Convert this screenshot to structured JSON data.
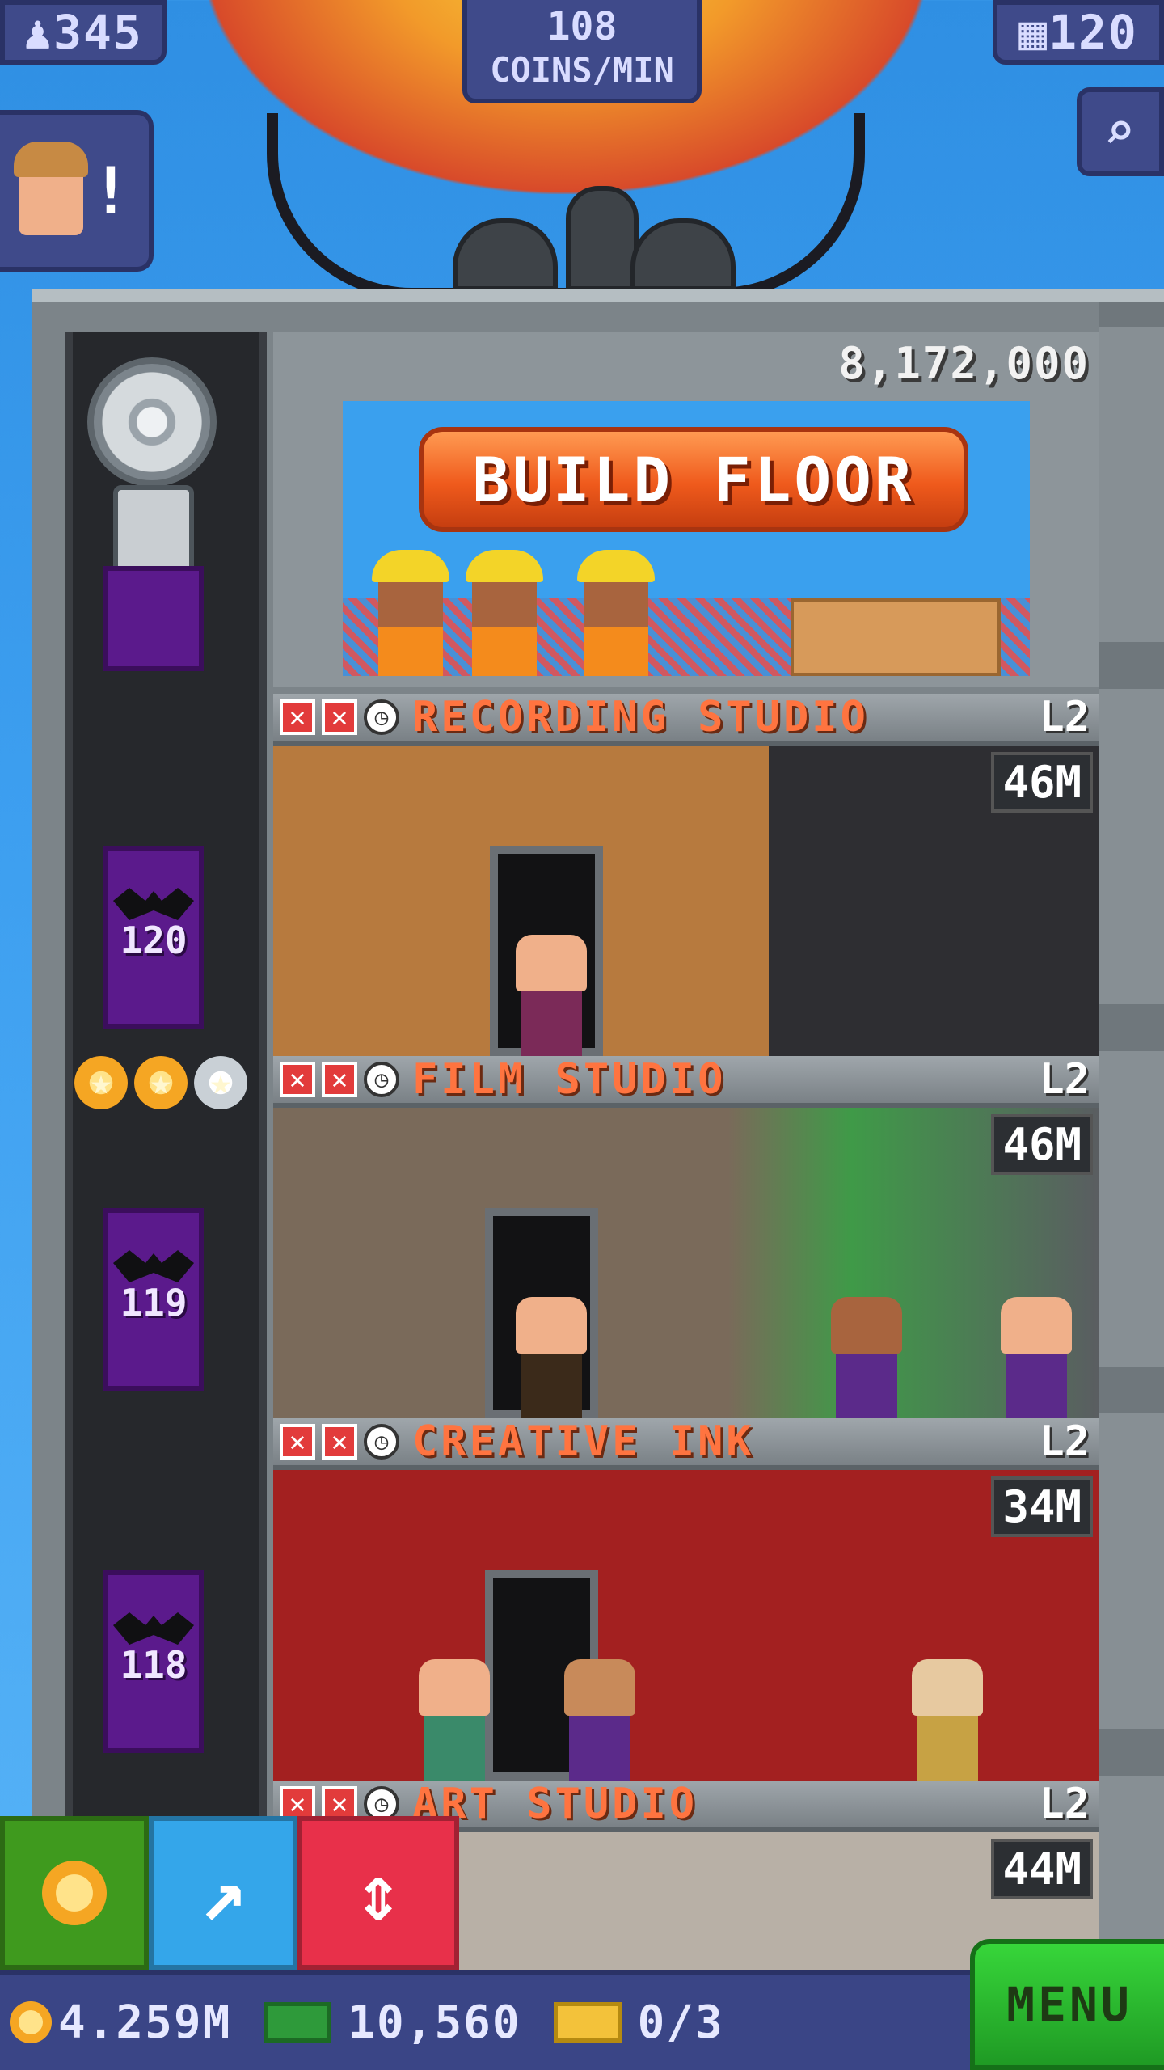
{
  "top": {
    "population": "345",
    "coins_per_min_value": "108",
    "coins_per_min_label": "COINS/MIN",
    "floors_count": "120"
  },
  "build_floor": {
    "price": "8,172,000",
    "button_label": "BUILD FLOOR"
  },
  "elevator": {
    "floor_numbers": [
      "120",
      "119",
      "118"
    ]
  },
  "floors": [
    {
      "name": "RECORDING STUDIO",
      "level": "L2",
      "value": "46M"
    },
    {
      "name": "FILM STUDIO",
      "level": "L2",
      "value": "46M"
    },
    {
      "name": "CREATIVE INK",
      "level": "L2",
      "value": "34M"
    },
    {
      "name": "ART STUDIO",
      "level": "L2",
      "value": "44M"
    }
  ],
  "stars": {
    "filled": 2,
    "total": 3
  },
  "bottom": {
    "coins": "4.259M",
    "bux": "10,560",
    "tickets": "0/3",
    "menu_label": "MENU"
  },
  "colors": {
    "sky": "#3d9ff0",
    "build_button": "#ef5a1c",
    "floor_name": "#ff7440",
    "elevator": "#5b1a8c",
    "menu": "#37d63a"
  },
  "icons": {
    "population": "person-icon",
    "floors": "building-icon",
    "search": "magnifier-icon",
    "coins_action": "coins-icon",
    "bitizen_action": "arrow-icon",
    "elevator_action": "up-down-icon"
  }
}
